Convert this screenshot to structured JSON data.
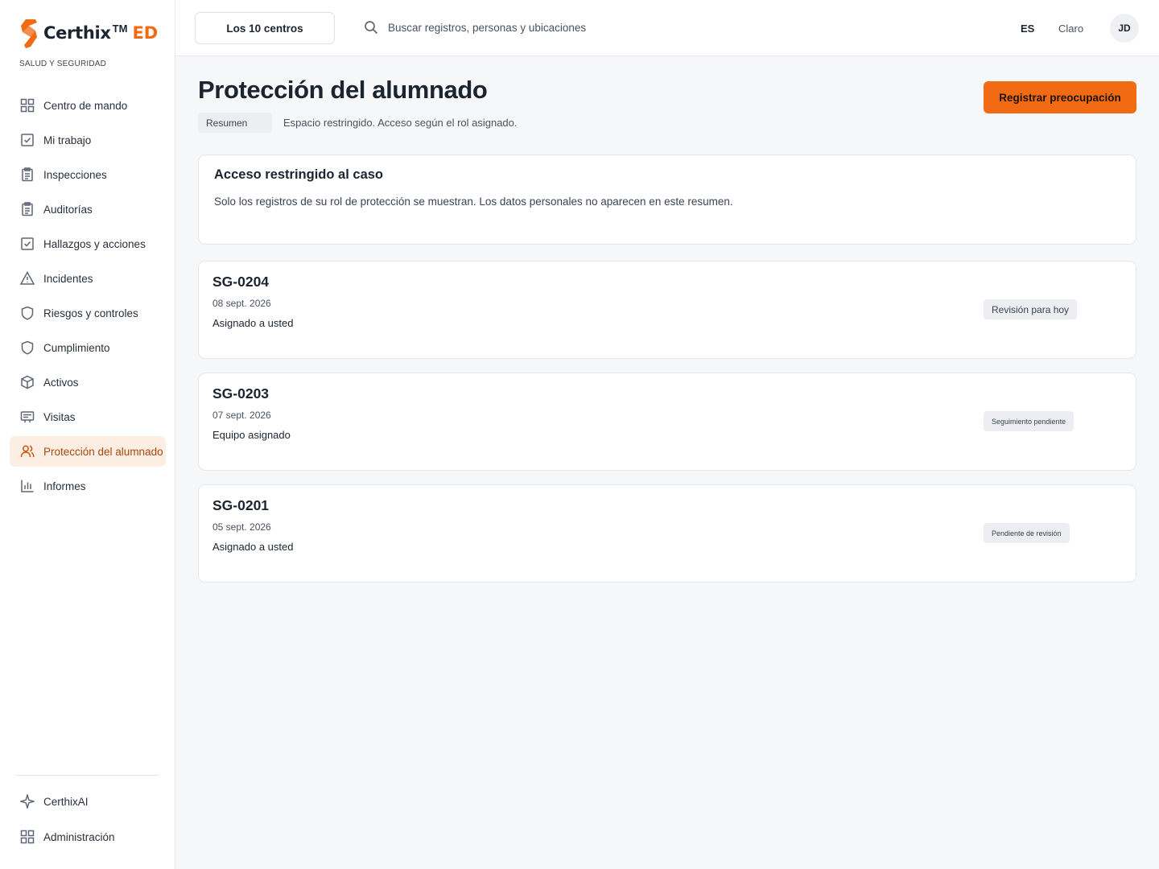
{
  "brand": {
    "name": "Certhix",
    "tm": "TM",
    "edition": "ED",
    "subtitle": "SALUD Y SEGURIDAD",
    "accent_color": "#f26a12"
  },
  "sidebar": {
    "items": [
      {
        "label": "Centro de mando",
        "icon": "grid-icon"
      },
      {
        "label": "Mi trabajo",
        "icon": "checkbox-icon"
      },
      {
        "label": "Inspecciones",
        "icon": "clipboard-icon"
      },
      {
        "label": "Auditorías",
        "icon": "clipboard-icon"
      },
      {
        "label": "Hallazgos y acciones",
        "icon": "checkbox-icon"
      },
      {
        "label": "Incidentes",
        "icon": "warning-icon"
      },
      {
        "label": "Riesgos y controles",
        "icon": "shield-icon"
      },
      {
        "label": "Cumplimiento",
        "icon": "shield-icon"
      },
      {
        "label": "Activos",
        "icon": "box-icon"
      },
      {
        "label": "Visitas",
        "icon": "id-card-icon"
      },
      {
        "label": "Protección del alumnado",
        "icon": "users-icon",
        "active": true
      },
      {
        "label": "Informes",
        "icon": "bar-chart-icon"
      }
    ],
    "bottom_items": [
      {
        "label": "CerthixAI",
        "icon": "sparkle-icon"
      },
      {
        "label": "Administración",
        "icon": "grid-icon"
      }
    ]
  },
  "topbar": {
    "site_selector": "Los 10 centros",
    "search_placeholder": "Buscar registros, personas y ubicaciones",
    "language": "ES",
    "theme": "Claro",
    "avatar_initials": "JD"
  },
  "page": {
    "title": "Protección del alumnado",
    "tab": "Resumen",
    "subtitle": "Espacio restringido. Acceso según el rol asignado.",
    "primary_action": "Registrar preocupación"
  },
  "notice": {
    "title": "Acceso restringido al caso",
    "text": "Solo los registros de su rol de protección se muestran. Los datos personales no aparecen en este resumen."
  },
  "cases": [
    {
      "id": "SG-0204",
      "date": "08 sept. 2026",
      "assignment": "Asignado a usted",
      "status": "Revisión para hoy"
    },
    {
      "id": "SG-0203",
      "date": "07 sept. 2026",
      "assignment": "Equipo asignado",
      "status": "Seguimiento pendiente"
    },
    {
      "id": "SG-0201",
      "date": "05 sept. 2026",
      "assignment": "Asignado a usted",
      "status": "Pendiente de revisión"
    }
  ]
}
